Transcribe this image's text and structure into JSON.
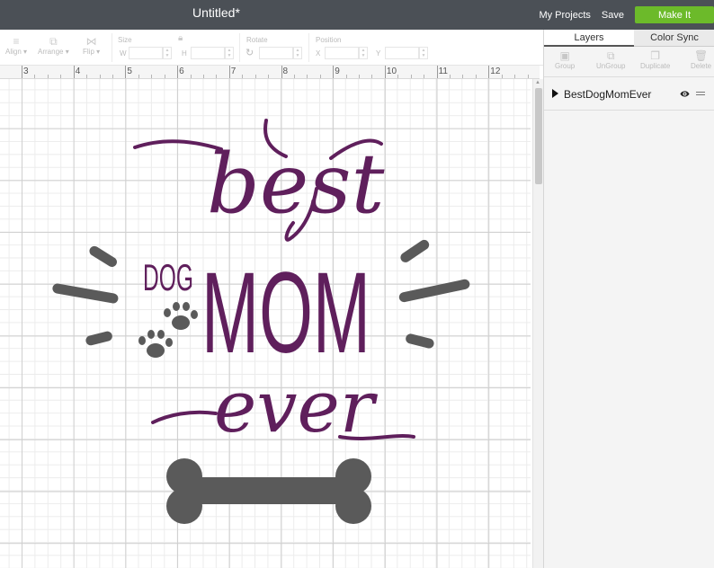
{
  "header": {
    "title": "Untitled*",
    "my_projects": "My Projects",
    "save": "Save",
    "make_it": "Make It"
  },
  "toolbar": {
    "align": "Align",
    "arrange": "Arrange",
    "flip": "Flip",
    "size": "Size",
    "size_w": "W",
    "size_h": "H",
    "rotate": "Rotate",
    "position": "Position",
    "pos_x": "X",
    "pos_y": "Y"
  },
  "ruler": {
    "labels": [
      "3",
      "4",
      "5",
      "6",
      "7",
      "8",
      "9",
      "10",
      "11",
      "12"
    ]
  },
  "panel": {
    "tab_layers": "Layers",
    "tab_color_sync": "Color Sync",
    "tools": {
      "group": "Group",
      "ungroup": "UnGroup",
      "duplicate": "Duplicate",
      "delete": "Delete"
    },
    "layers": [
      {
        "name": "BestDogMomEver"
      }
    ]
  },
  "design": {
    "word_best": "best",
    "word_dog": "DOG",
    "word_mom": "MOM",
    "word_ever": "ever",
    "colors": {
      "purple": "#5f1f5c",
      "gray": "#5a5a5a",
      "accent_green": "#6cba2a",
      "topbar": "#4b5056"
    }
  }
}
